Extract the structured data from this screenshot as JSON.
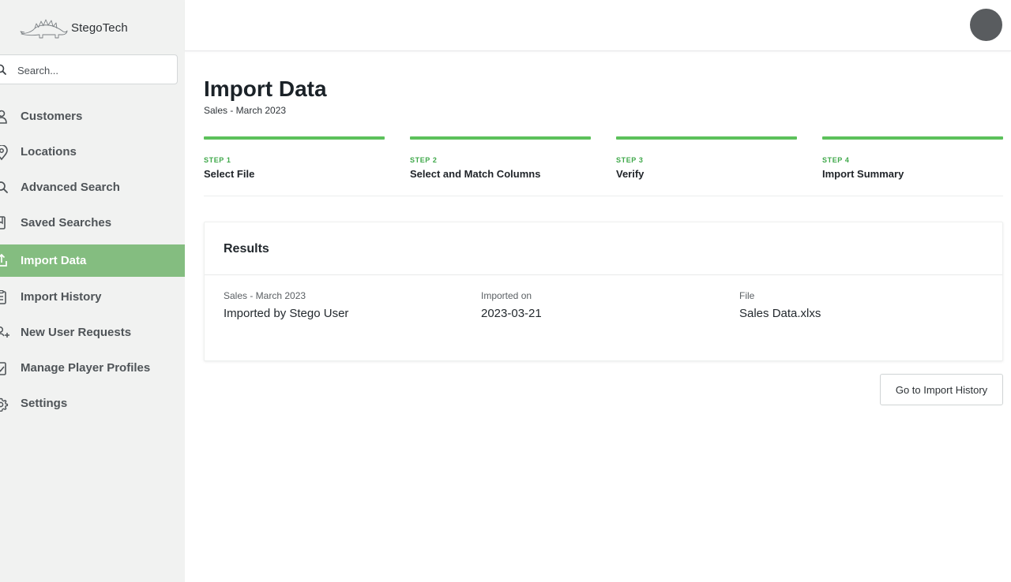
{
  "brand": {
    "name": "StegoTech"
  },
  "search": {
    "placeholder": "Search..."
  },
  "sidebar": {
    "items": [
      {
        "label": "Customers",
        "icon": "customers-icon",
        "active": false
      },
      {
        "label": "Locations",
        "icon": "location-pin-icon",
        "active": false
      },
      {
        "label": "Advanced Search",
        "icon": "search-icon",
        "active": false
      },
      {
        "label": "Saved Searches",
        "icon": "bookmark-icon",
        "active": false
      },
      {
        "label": "Import Data",
        "icon": "upload-icon",
        "active": true
      },
      {
        "label": "Import History",
        "icon": "clipboard-icon",
        "active": false
      },
      {
        "label": "New User Requests",
        "icon": "add-user-icon",
        "active": false
      },
      {
        "label": "Manage Player Profiles",
        "icon": "profile-check-icon",
        "active": false
      },
      {
        "label": "Settings",
        "icon": "gear-icon",
        "active": false
      }
    ]
  },
  "page": {
    "title": "Import Data",
    "subtitle": "Sales - March 2023"
  },
  "steps": [
    {
      "number": "STEP 1",
      "name": "Select File",
      "complete": true
    },
    {
      "number": "STEP 2",
      "name": "Select and Match Columns",
      "complete": true
    },
    {
      "number": "STEP 3",
      "name": "Verify",
      "complete": true
    },
    {
      "number": "STEP 4",
      "name": "Import Summary",
      "complete": true
    }
  ],
  "results": {
    "title": "Results",
    "columns": [
      {
        "label": "Sales - March 2023",
        "value": "Imported by Stego User"
      },
      {
        "label": "Imported on",
        "value": "2023-03-21"
      },
      {
        "label": "File",
        "value": "Sales Data.xlxs"
      }
    ]
  },
  "actions": {
    "history_button": "Go to Import History"
  },
  "colors": {
    "accent": "#5cc15b",
    "sidebar_active": "#84bd80",
    "sidebar_bg": "#f1f2f1",
    "avatar": "#595c5f"
  }
}
